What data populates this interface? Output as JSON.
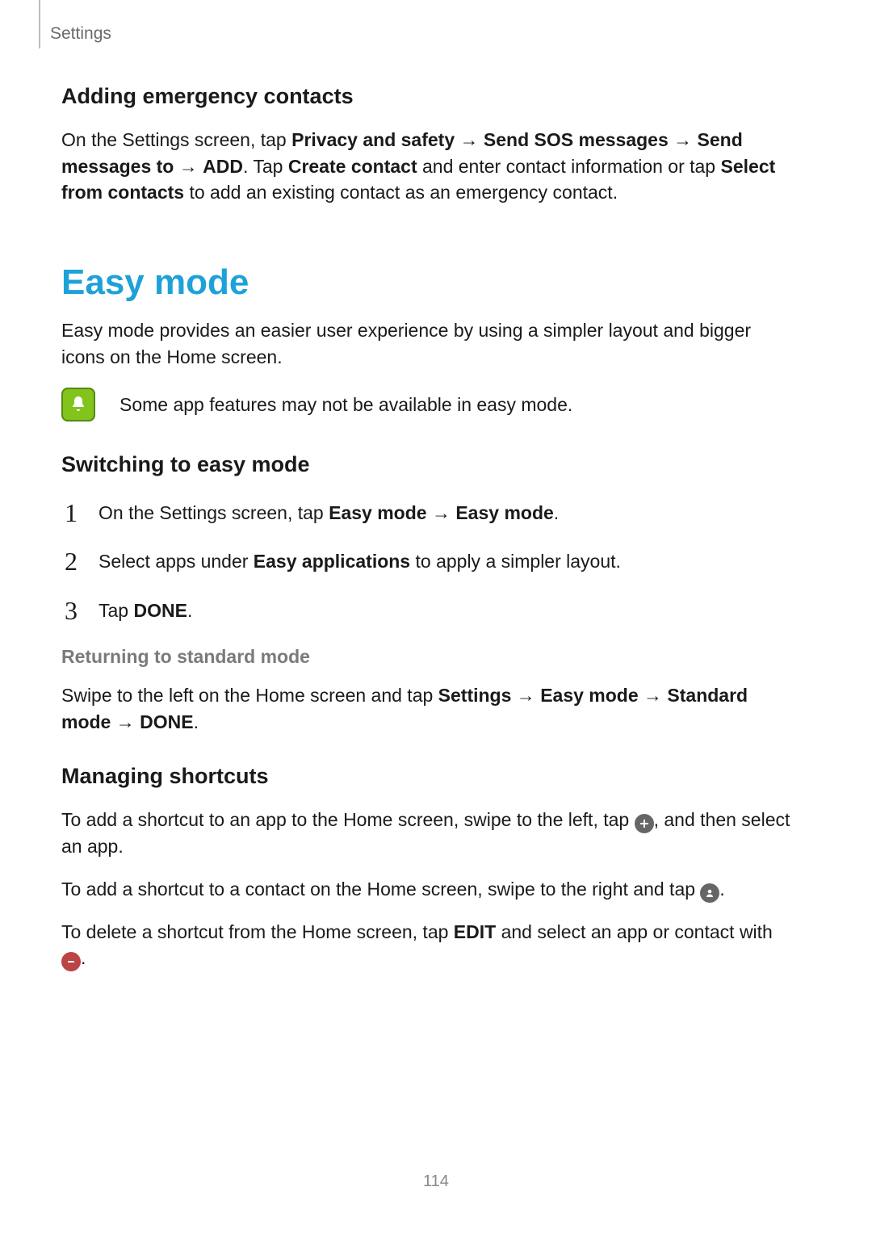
{
  "header": {
    "label": "Settings"
  },
  "emergency": {
    "heading": "Adding emergency contacts",
    "p1_before": "On the Settings screen, tap ",
    "p1_bold1": "Privacy and safety",
    "p1_arrow1": " → ",
    "p1_bold2": "Send SOS messages",
    "p1_arrow2": " → ",
    "p1_bold3": "Send messages to",
    "p1_arrow3": " → ",
    "p1_bold4": "ADD",
    "p1_mid": ". Tap ",
    "p1_bold5": "Create contact",
    "p1_mid2": " and enter contact information or tap ",
    "p1_bold6": "Select from contacts",
    "p1_after": " to add an existing contact as an emergency contact."
  },
  "easymode": {
    "title": "Easy mode",
    "intro": "Easy mode provides an easier user experience by using a simpler layout and bigger icons on the Home screen.",
    "note": "Some app features may not be available in easy mode.",
    "switching_heading": "Switching to easy mode",
    "steps": {
      "s1_before": "On the Settings screen, tap ",
      "s1_bold1": "Easy mode",
      "s1_arrow": " → ",
      "s1_bold2": "Easy mode",
      "s1_after": ".",
      "s2_before": "Select apps under ",
      "s2_bold": "Easy applications",
      "s2_after": " to apply a simpler layout.",
      "s3_before": "Tap ",
      "s3_bold": "DONE",
      "s3_after": "."
    },
    "returning_heading": "Returning to standard mode",
    "returning_before": "Swipe to the left on the Home screen and tap ",
    "returning_bold1": "Settings",
    "returning_a1": " → ",
    "returning_bold2": "Easy mode",
    "returning_a2": " → ",
    "returning_bold3": "Standard mode",
    "returning_a3": " → ",
    "returning_bold4": "DONE",
    "returning_after": "."
  },
  "shortcuts": {
    "heading": "Managing shortcuts",
    "p1_before": "To add a shortcut to an app to the Home screen, swipe to the left, tap ",
    "p1_after": ", and then select an app.",
    "p2_before": "To add a shortcut to a contact on the Home screen, swipe to the right and tap ",
    "p2_after": ".",
    "p3_before": "To delete a shortcut from the Home screen, tap ",
    "p3_bold": "EDIT",
    "p3_mid": " and select an app or contact with ",
    "p3_after": "."
  },
  "page_number": "114"
}
